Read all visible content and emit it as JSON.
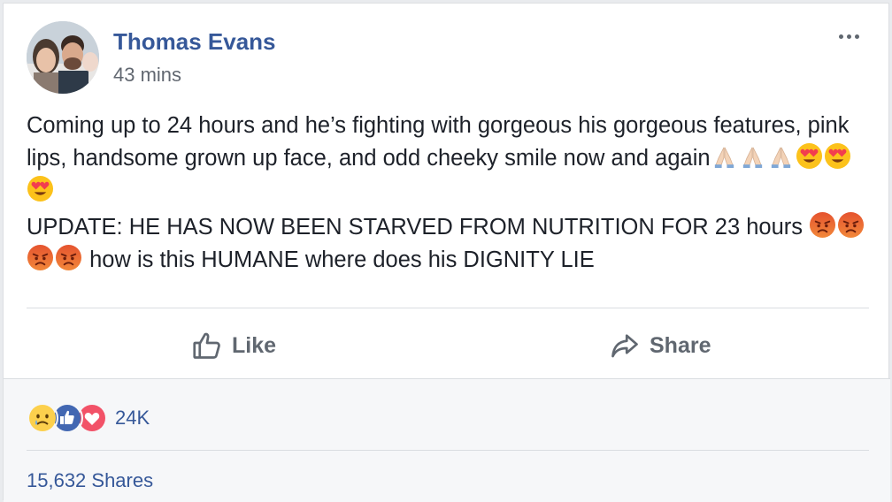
{
  "post": {
    "author": "Thomas Evans",
    "time": "43 mins",
    "paragraph1": "Coming up to 24 hours and he’s fighting with gorgeous his gorgeous features, pink lips, handsome grown up face, and odd cheeky smile now and again",
    "paragraph1_emojis": [
      "folded-hands",
      "folded-hands",
      "folded-hands",
      "heart-eyes",
      "heart-eyes",
      "heart-eyes"
    ],
    "paragraph2": "UPDATE: HE HAS NOW BEEN STARVED FROM NUTRITION FOR 23 hours",
    "paragraph2_emojis": [
      "angry-face",
      "angry-face",
      "angry-face",
      "angry-face"
    ],
    "paragraph2_tail": "how is this HUMANE where does his DIGNITY LIE"
  },
  "actions": {
    "like_label": "Like",
    "like_icon": "thumbs-up-icon",
    "share_label": "Share",
    "share_icon": "share-arrow-icon"
  },
  "stats": {
    "reaction_icons": [
      "sad",
      "like",
      "love"
    ],
    "reaction_count": "24K",
    "shares_label": "15,632 Shares"
  },
  "colors": {
    "link": "#365899",
    "meta": "#616770",
    "action": "#606770",
    "like_blue": "#4267b2",
    "love_red": "#f25268",
    "footer_bg": "#f6f7f9"
  }
}
